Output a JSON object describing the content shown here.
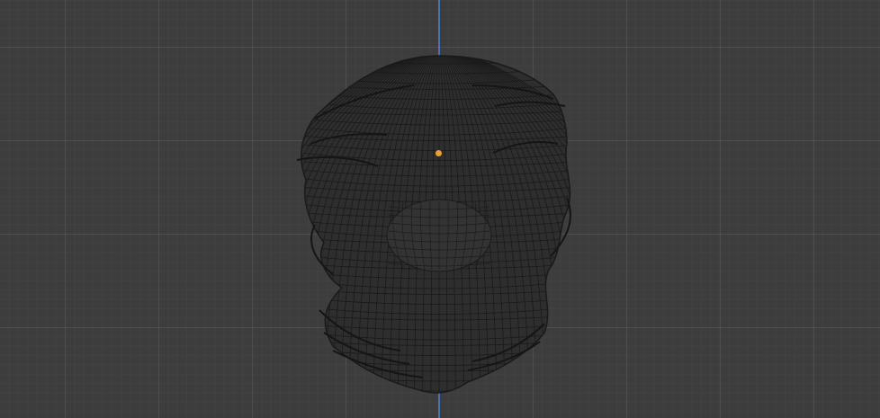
{
  "viewport": {
    "background_color": "#3d3d3d",
    "axis_color": "#4a78c2",
    "origin_color": "#f0a030",
    "wire_color": "#1a1a1a",
    "object": "hair-mesh-wireframe"
  }
}
